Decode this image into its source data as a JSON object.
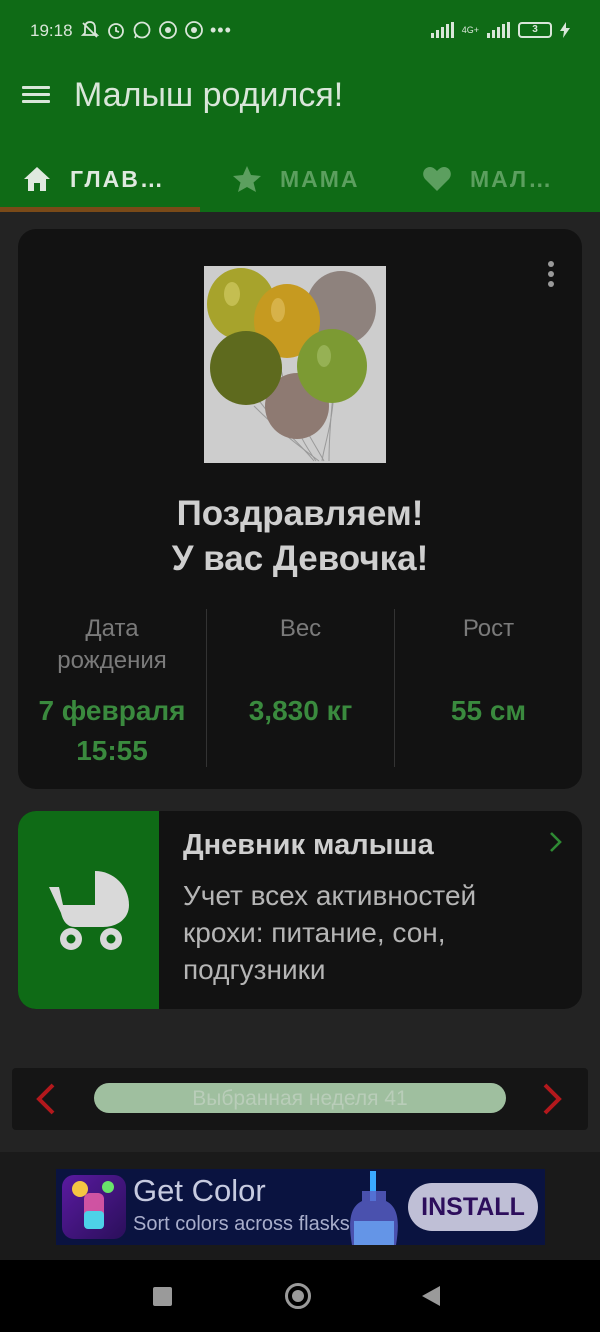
{
  "status_bar": {
    "time": "19:18",
    "icons": [
      "bell-off-icon",
      "alarm-icon",
      "whatsapp-icon",
      "chrome-icon",
      "chrome-icon",
      "more-dots-icon"
    ],
    "network": "4G+",
    "battery": "3"
  },
  "app_bar": {
    "title": "Малыш родился!"
  },
  "tabs": [
    {
      "label": "ГЛАВ…",
      "icon": "home-icon",
      "active": true
    },
    {
      "label": "МАМА",
      "icon": "star-icon",
      "active": false
    },
    {
      "label": "МАЛ…",
      "icon": "heart-icon",
      "active": false
    }
  ],
  "congrats_card": {
    "title_line1": "Поздравляем!",
    "title_line2": "У вас Девочка!",
    "stats": [
      {
        "label": "Дата рождения",
        "value": "7 февраля 15:55"
      },
      {
        "label": "Вес",
        "value": "3,830 кг"
      },
      {
        "label": "Рост",
        "value": "55 см"
      }
    ]
  },
  "diary_card": {
    "title": "Дневник малыша",
    "description": "Учет всех активностей крохи: питание, сон, подгузники",
    "icon": "stroller-icon"
  },
  "week_selector": {
    "label": "Выбранная неделя 41"
  },
  "ad": {
    "title": "Get Color",
    "subtitle": "Sort colors across flasks",
    "install_label": "INSTALL"
  },
  "colors": {
    "primary_green": "#0f6b16",
    "accent_green": "#3a8a3e",
    "tab_indicator": "#7a4a18",
    "arrow_red": "#b3181c"
  }
}
